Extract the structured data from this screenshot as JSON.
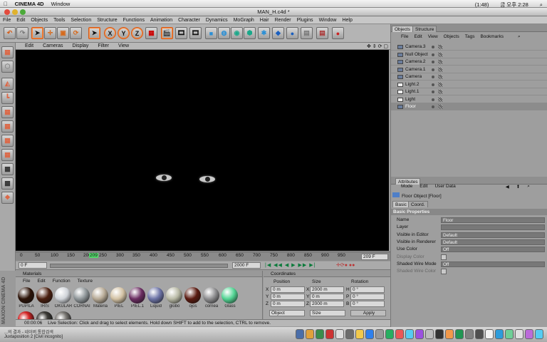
{
  "macmenu": {
    "app": "CINEMA 4D",
    "items": [
      "Window"
    ],
    "clock": "금 오후 2:28",
    "battery": "(1:48)",
    "status_icons": [
      "spotlight-icon",
      "wifi-icon",
      "battery-icon",
      "bluetooth-icon"
    ]
  },
  "window": {
    "title": "MAN_H.c4d *"
  },
  "menus": [
    "File",
    "Edit",
    "Objects",
    "Tools",
    "Selection",
    "Structure",
    "Functions",
    "Animation",
    "Character",
    "Dynamics",
    "MoGraph",
    "Hair",
    "Render",
    "Plugins",
    "Window",
    "Help"
  ],
  "toolbar": {
    "icons": [
      "undo-icon",
      "redo-icon",
      "select-cursor-icon",
      "move-icon",
      "scale-icon",
      "rotate-icon",
      "live-select-icon",
      "x-axis-icon",
      "y-axis-icon",
      "z-axis-icon",
      "world-coord-icon",
      "render-view-icon",
      "render-picture-icon",
      "render-settings-icon",
      "cube-icon",
      "spline-icon",
      "nurbs-icon",
      "array-icon",
      "deformer-icon",
      "scene-icon",
      "light-icon",
      "camera-icon",
      "particle-icon",
      "record-icon"
    ],
    "axis_labels": [
      "X",
      "Y",
      "Z"
    ]
  },
  "viewport": {
    "menu": [
      "Edit",
      "Cameras",
      "Display",
      "Filter",
      "View"
    ]
  },
  "timeline": {
    "ticks": [
      "0",
      "50",
      "100",
      "150",
      "200",
      "209",
      "250",
      "300",
      "350",
      "400",
      "450",
      "500",
      "550",
      "600",
      "650",
      "700",
      "750",
      "800",
      "850",
      "900",
      "950",
      "100"
    ],
    "current_frame": "209 F",
    "start_field": "0 F",
    "end_field": "2000 F"
  },
  "materials": {
    "title": "Materials",
    "menu": [
      "File",
      "Edit",
      "Function",
      "Texture"
    ],
    "items": [
      {
        "label": "PUPILA",
        "color": "#2b1207"
      },
      {
        "label": "IRIS",
        "color": "#4a1f0f"
      },
      {
        "label": "OKULAR",
        "color": "#cfd3d8"
      },
      {
        "label": "CORNAI",
        "color": "#8f9699"
      },
      {
        "label": "Materia",
        "color": "#b7aa96"
      },
      {
        "label": "PIEL",
        "color": "#d2c1a3"
      },
      {
        "label": "PIEL.1",
        "color": "#6b2d62"
      },
      {
        "label": "Liquid",
        "color": "#6c73a6"
      },
      {
        "label": "globo",
        "color": "#b8b9a5"
      },
      {
        "label": "ojos",
        "color": "#5a1a10"
      },
      {
        "label": "cornea",
        "color": "#8e8e90"
      },
      {
        "label": "Glass",
        "color": "#52d493"
      }
    ],
    "extra_row": [
      "#d42424",
      "#3c3a36",
      "#7c7a76"
    ]
  },
  "coordinates": {
    "title": "Coordinates",
    "headers": [
      "Position",
      "Size",
      "Rotation"
    ],
    "rows": [
      {
        "axis": "X",
        "pos": "0 m",
        "size": "2000 m",
        "rot_label": "H",
        "rot": "0 °"
      },
      {
        "axis": "Y",
        "pos": "0 m",
        "size": "0 m",
        "rot_label": "P",
        "rot": "0 °"
      },
      {
        "axis": "Z",
        "pos": "0 m",
        "size": "2000 m",
        "rot_label": "B",
        "rot": "0 °"
      }
    ],
    "mode_select": "Object",
    "size_select": "Size",
    "apply_label": "Apply"
  },
  "status": {
    "time": "00:00:06",
    "message": "Live Selection: Click and drag to select elements. Hold down SHIFT to add to the selection, CTRL to remove."
  },
  "objects_panel": {
    "tabs": [
      "Objects",
      "Structure"
    ],
    "menu": [
      "File",
      "Edit",
      "View",
      "Objects",
      "Tags",
      "Bookmarks"
    ],
    "rows": [
      {
        "name": "Camera.3"
      },
      {
        "name": "Null Object"
      },
      {
        "name": "Camera.2"
      },
      {
        "name": "Camera.1"
      },
      {
        "name": "Camera"
      },
      {
        "name": "Light.2"
      },
      {
        "name": "Light.1"
      },
      {
        "name": "Light"
      },
      {
        "name": "Floor"
      }
    ]
  },
  "attributes_panel": {
    "tab": "Attributes",
    "menu": [
      "Mode",
      "Edit",
      "User Data"
    ],
    "object_title": "Floor Object [Floor]",
    "subtabs": [
      "Basic",
      "Coord."
    ],
    "section": "Basic Properties",
    "rows": [
      {
        "label": "Name",
        "value": "Floor"
      },
      {
        "label": "Layer",
        "value": ""
      },
      {
        "label": "Visible in Editor",
        "value": "Default"
      },
      {
        "label": "Visible in Renderer",
        "value": "Default"
      },
      {
        "label": "Use Color",
        "value": "Off"
      },
      {
        "label": "Display Color",
        "value": ""
      },
      {
        "label": "Shaded Wire Mode",
        "value": "Off"
      },
      {
        "label": "Shaded Wire Color",
        "value": ""
      }
    ]
  },
  "dock": {
    "window_label": "Juxtaposition 2 [Civil incognito]",
    "left_label": "...의 결과 - 네이버 통합검색"
  },
  "vertical_brand": "MAXON CINEMA 4D",
  "accent_color": "#ff8b3d"
}
